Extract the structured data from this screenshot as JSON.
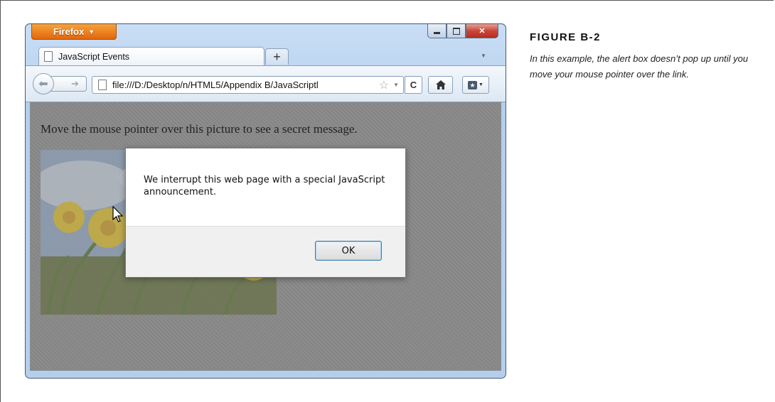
{
  "browser": {
    "app_menu_label": "Firefox",
    "tab_title": "JavaScript Events",
    "new_tab_label": "+",
    "url": "file:///D:/Desktop/n/HTML5/Appendix B/JavaScriptl",
    "content_text": "Move the mouse pointer over this picture to see a secret message."
  },
  "alert": {
    "message": "We interrupt this web page with a special JavaScript announcement.",
    "ok_label": "OK"
  },
  "caption": {
    "title": "FIGURE B-2",
    "text": "In this example, the alert box doesn’t pop up until you move your mouse pointer over the link."
  }
}
